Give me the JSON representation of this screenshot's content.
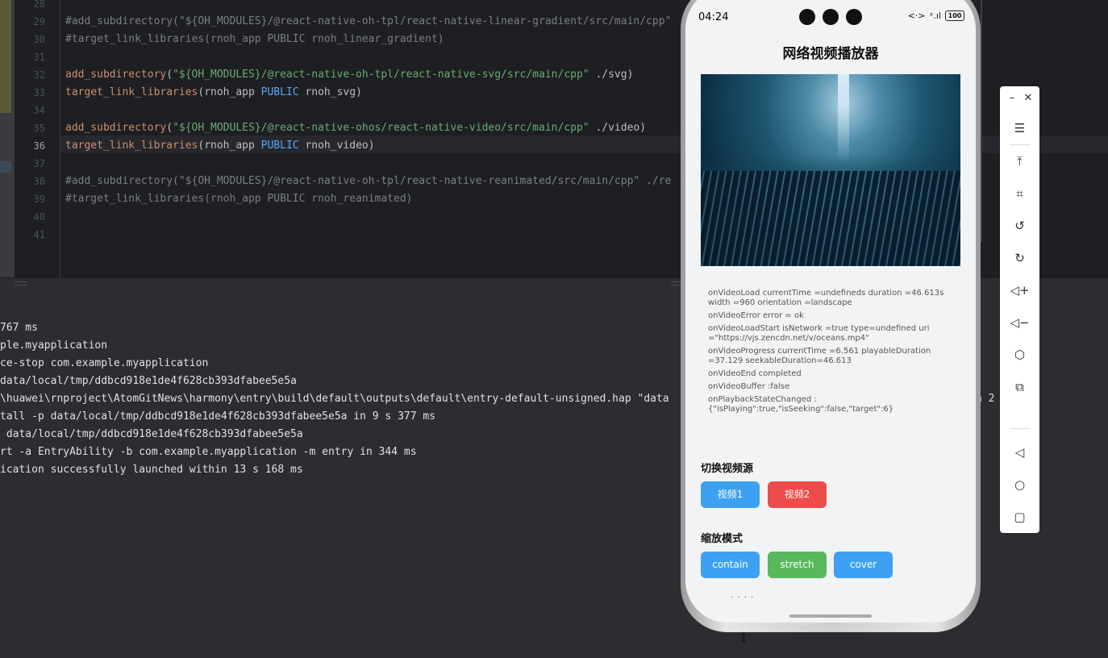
{
  "editor": {
    "lines": [
      {
        "num": "28",
        "segments": []
      },
      {
        "num": "29",
        "segments": [
          {
            "cls": "c-comment",
            "text": "#add_subdirectory(\"${OH_MODULES}/@react-native-oh-tpl/react-native-linear-gradient/src/main/cpp\""
          }
        ]
      },
      {
        "num": "30",
        "segments": [
          {
            "cls": "c-comment",
            "text": "#target_link_libraries(rnoh_app PUBLIC rnoh_linear_gradient)"
          }
        ]
      },
      {
        "num": "31",
        "segments": []
      },
      {
        "num": "32",
        "segments": [
          {
            "cls": "c-fn",
            "text": "add_subdirectory"
          },
          {
            "cls": "c-plain",
            "text": "("
          },
          {
            "cls": "c-str",
            "text": "\"${OH_MODULES}/@react-native-oh-tpl/react-native-svg/src/main/cpp\""
          },
          {
            "cls": "c-plain",
            "text": " ./svg)"
          }
        ]
      },
      {
        "num": "33",
        "segments": [
          {
            "cls": "c-fn",
            "text": "target_link_libraries"
          },
          {
            "cls": "c-plain",
            "text": "(rnoh_app "
          },
          {
            "cls": "c-kw",
            "text": "PUBLIC"
          },
          {
            "cls": "c-plain",
            "text": " rnoh_svg)"
          }
        ]
      },
      {
        "num": "34",
        "segments": []
      },
      {
        "num": "35",
        "segments": [
          {
            "cls": "c-fn",
            "text": "add_subdirectory"
          },
          {
            "cls": "c-plain",
            "text": "("
          },
          {
            "cls": "c-str",
            "text": "\"${OH_MODULES}/@react-native-ohos/react-native-video/src/main/cpp\""
          },
          {
            "cls": "c-plain",
            "text": " ./video)"
          }
        ]
      },
      {
        "num": "36",
        "segments": [
          {
            "cls": "c-fn",
            "text": "target_link_libraries"
          },
          {
            "cls": "c-plain",
            "text": "(rnoh_app "
          },
          {
            "cls": "c-kw",
            "text": "PUBLIC"
          },
          {
            "cls": "c-plain",
            "text": " rnoh_video)"
          }
        ]
      },
      {
        "num": "37",
        "segments": []
      },
      {
        "num": "38",
        "segments": [
          {
            "cls": "c-comment",
            "text": "#add_subdirectory(\"${OH_MODULES}/@react-native-oh-tpl/react-native-reanimated/src/main/cpp\" ./re"
          }
        ]
      },
      {
        "num": "39",
        "segments": [
          {
            "cls": "c-comment",
            "text": "#target_link_libraries(rnoh_app PUBLIC rnoh_reanimated)"
          }
        ]
      },
      {
        "num": "40",
        "segments": []
      },
      {
        "num": "41",
        "segments": []
      }
    ]
  },
  "console": {
    "lines": [
      "767 ms",
      "ple.myapplication",
      "ce-stop com.example.myapplication",
      "data/local/tmp/ddbcd918e1de4f628cb393dfabee5e5a",
      "\\huawei\\rnproject\\AtomGitNews\\harmony\\entry\\build\\default\\outputs\\default\\entry-default-unsigned.hap \"data",
      "tall -p data/local/tmp/ddbcd918e1de4f628cb393dfabee5e5a in 9 s 377 ms",
      " data/local/tmp/ddbcd918e1de4f628cb393dfabee5e5a",
      "rt -a EntryAbility -b com.example.myapplication -m entry in 344 ms",
      "ication successfully launched within 13 s 168 ms"
    ],
    "overflow_tail": "n 2 ms"
  },
  "phone": {
    "status_time": "04:24",
    "battery": "100",
    "title": "网络视频播放器",
    "events": [
      "onVideoLoad currentTime =undefineds duration =46.613s width =960 orientation =landscape",
      "onVideoError error = ok",
      "onVideoLoadStart isNetwork =true type=undefined uri =\"https://vjs.zencdn.net/v/oceans.mp4\"",
      "onVideoProgress currentTime =6.561 playableDuration =37.129 seekableDuration=46.613",
      "onVideoEnd completed",
      "onVideoBuffer :false",
      "onPlaybackStateChanged : {\"isPlaying\":true,\"isSeeking\":false,\"target\":6}"
    ],
    "switch_source_label": "切换视频源",
    "source_buttons": [
      "视频1",
      "视频2"
    ],
    "resize_mode_label": "缩放模式",
    "mode_buttons": [
      "contain",
      "stretch",
      "cover"
    ],
    "more": "· · · ·",
    "colors": {
      "blue": "#3ea0f2",
      "red": "#ee4b4b",
      "green": "#57b85c"
    }
  },
  "toolbar": {
    "icons": [
      "minimize-icon",
      "close-icon",
      "menu-icon",
      "pin-top-icon",
      "crop-icon",
      "rotate-left-icon",
      "rotate-right-icon",
      "volume-up-icon",
      "volume-down-icon",
      "shake-icon",
      "multi-screen-icon",
      "back-icon",
      "home-icon",
      "recents-icon"
    ]
  }
}
